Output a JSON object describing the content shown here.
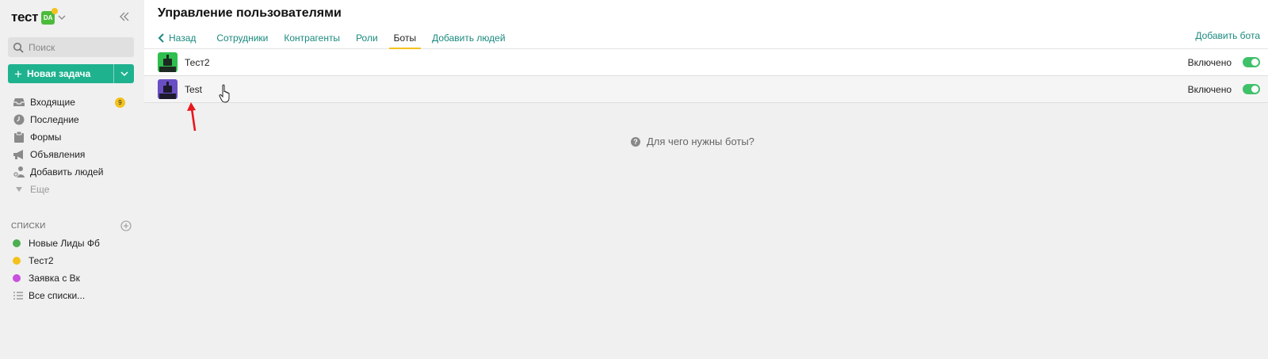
{
  "sidebar": {
    "workspace_name": "тест",
    "workspace_badge": "DA",
    "search": {
      "placeholder": "Поиск"
    },
    "new_task_label": "Новая задача",
    "nav": [
      {
        "label": "Входящие",
        "icon": "inbox-icon",
        "count": "9"
      },
      {
        "label": "Последние",
        "icon": "clock-icon"
      },
      {
        "label": "Формы",
        "icon": "clipboard-icon"
      },
      {
        "label": "Объявления",
        "icon": "megaphone-icon"
      },
      {
        "label": "Добавить людей",
        "icon": "add-people-icon"
      },
      {
        "label": "Еще",
        "icon": "caret-down-icon"
      }
    ],
    "lists_title": "Списки",
    "lists": [
      {
        "label": "Новые Лиды Фб",
        "color": "#4caf50"
      },
      {
        "label": "Тест2",
        "color": "#f3c21b"
      },
      {
        "label": "Заявка с Вк",
        "color": "#c94fdf"
      },
      {
        "label": "Все списки...",
        "icon": "list-icon"
      }
    ]
  },
  "header": {
    "title": "Управление пользователями",
    "back_label": "Назад",
    "tabs": [
      {
        "label": "Сотрудники"
      },
      {
        "label": "Контрагенты"
      },
      {
        "label": "Роли"
      },
      {
        "label": "Боты",
        "active": true
      },
      {
        "label": "Добавить людей"
      }
    ],
    "add_bot_label": "Добавить бота"
  },
  "bots": [
    {
      "name": "Тест2",
      "status": "Включено",
      "enabled": true,
      "avatar_color": "#2fbf4f"
    },
    {
      "name": "Test",
      "status": "Включено",
      "enabled": true,
      "avatar_color": "#6a4fc4"
    }
  ],
  "help_text": "Для чего нужны боты?",
  "colors": {
    "accent": "#1fb28f",
    "link": "#1a8a7e",
    "tab_underline": "#f3c21b",
    "toggle_on": "#3fc16a"
  }
}
